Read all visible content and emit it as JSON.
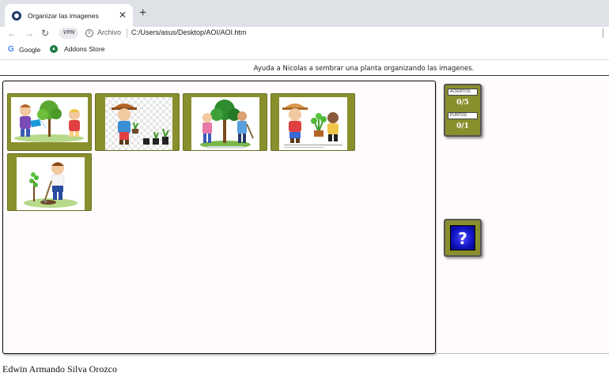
{
  "browser": {
    "tab_title": "Organizar las imagenes",
    "tab_close": "✕",
    "new_tab": "+",
    "vpn_label": "VPN",
    "scheme_label": "Archivo",
    "url": "C:/Users/asus/Desktop/AOI/AOI.htm",
    "bookmarks": [
      {
        "label": "Google",
        "icon": "google-icon"
      },
      {
        "label": "Addons Store",
        "icon": "addons-store-icon"
      }
    ]
  },
  "page": {
    "instruction": "Ayuda a Nicolas a sembrar una planta organizando las imagenes.",
    "cards": [
      {
        "icon": "kids-watering-tree-image"
      },
      {
        "icon": "boy-with-seedlings-image"
      },
      {
        "icon": "kids-planting-tree-image"
      },
      {
        "icon": "kids-with-potted-plant-image"
      },
      {
        "icon": "boy-digging-sapling-image"
      }
    ],
    "score": {
      "hits_label": "ACIERTOS:",
      "hits_value": "0/5",
      "points_label": "PUNTOS:",
      "points_value": "0/1"
    },
    "help_label": "?",
    "author": "Edwin Armando Silva Orozco"
  },
  "colors": {
    "card_olive": "#8a8f2e",
    "help_blue": "#1012c0",
    "workspace_bg": "#fffafc"
  }
}
